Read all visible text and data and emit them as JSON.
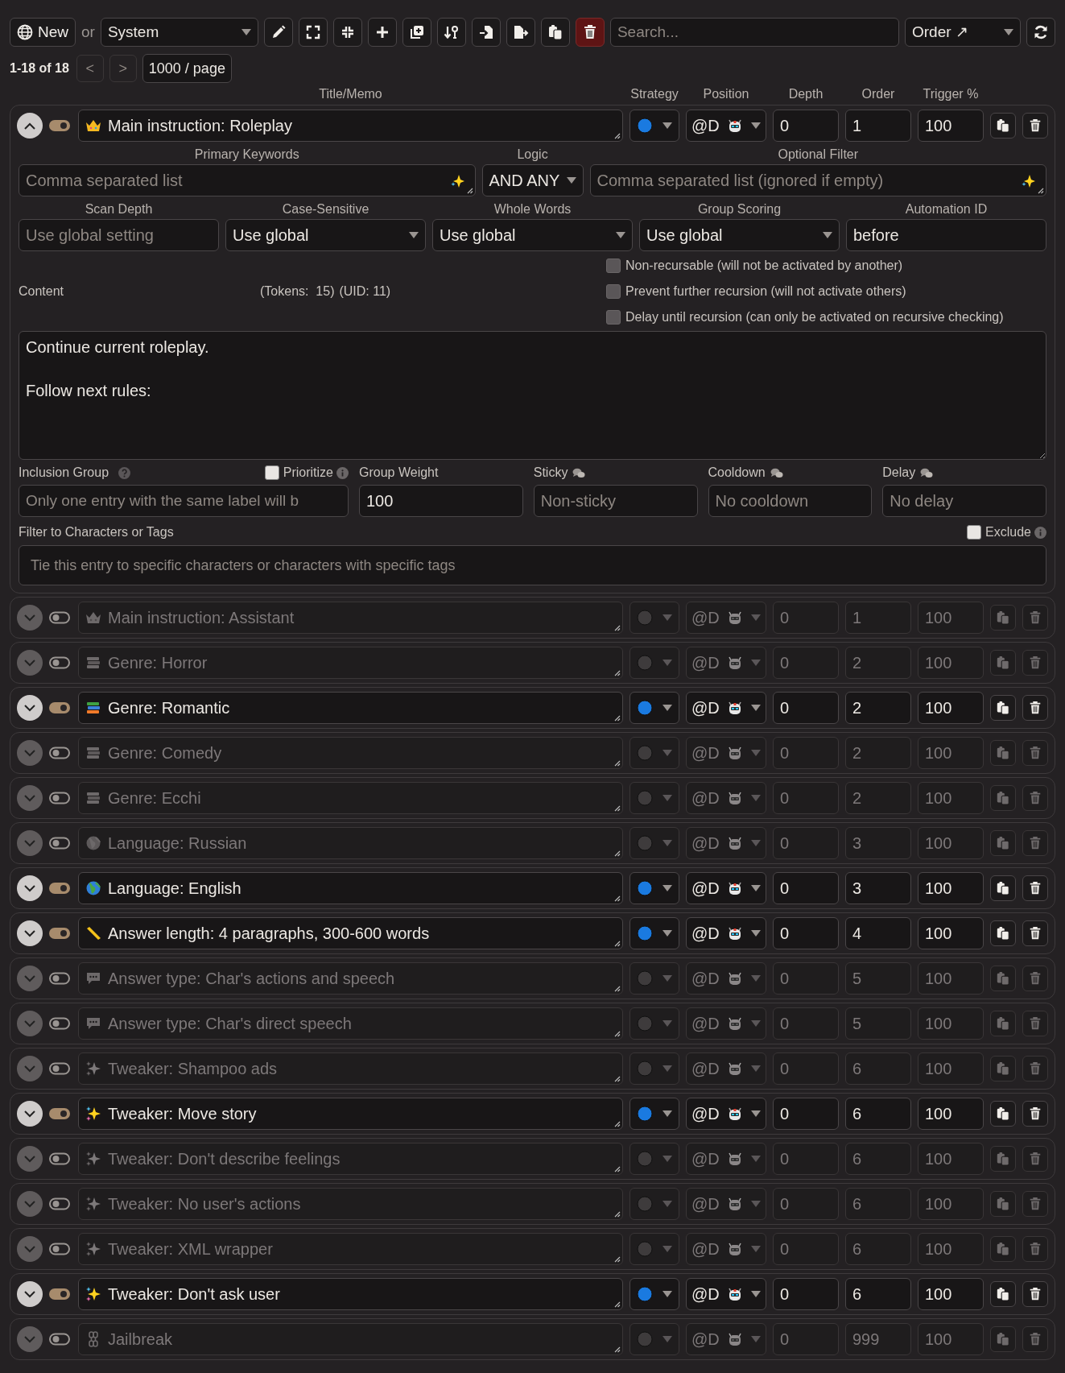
{
  "toolbar": {
    "new_button": "New",
    "or_label": "or",
    "book_select": "System",
    "search": {
      "placeholder": "Search..."
    },
    "sort_select": "Order ↗"
  },
  "pagination": {
    "range": "1-18 of 18",
    "prev": "<",
    "next": ">",
    "per_page": "1000 / page"
  },
  "column_headers": [
    "Title/Memo",
    "Strategy",
    "Position",
    "Depth",
    "Order",
    "Trigger %"
  ],
  "entries": [
    {
      "kind": "crown",
      "title": "Main instruction: Roleplay",
      "enabled": true,
      "expanded": true,
      "position": "@D",
      "depth": "0",
      "order": "1",
      "trigger": "100"
    },
    {
      "kind": "crown",
      "title": "Main instruction: Assistant",
      "enabled": false,
      "expanded": false,
      "position": "@D",
      "depth": "0",
      "order": "1",
      "trigger": "100"
    },
    {
      "kind": "books",
      "title": "Genre: Horror",
      "enabled": false,
      "expanded": false,
      "position": "@D",
      "depth": "0",
      "order": "2",
      "trigger": "100"
    },
    {
      "kind": "books",
      "title": "Genre: Romantic",
      "enabled": true,
      "expanded": false,
      "position": "@D",
      "depth": "0",
      "order": "2",
      "trigger": "100"
    },
    {
      "kind": "books",
      "title": "Genre: Comedy",
      "enabled": false,
      "expanded": false,
      "position": "@D",
      "depth": "0",
      "order": "2",
      "trigger": "100"
    },
    {
      "kind": "books",
      "title": "Genre: Ecchi",
      "enabled": false,
      "expanded": false,
      "position": "@D",
      "depth": "0",
      "order": "2",
      "trigger": "100"
    },
    {
      "kind": "globe",
      "title": "Language: Russian",
      "enabled": false,
      "expanded": false,
      "position": "@D",
      "depth": "0",
      "order": "3",
      "trigger": "100"
    },
    {
      "kind": "globe",
      "title": "Language: English",
      "enabled": true,
      "expanded": false,
      "position": "@D",
      "depth": "0",
      "order": "3",
      "trigger": "100"
    },
    {
      "kind": "ruler",
      "title": "Answer length: 4 paragraphs, 300-600 words",
      "enabled": true,
      "expanded": false,
      "position": "@D",
      "depth": "0",
      "order": "4",
      "trigger": "100"
    },
    {
      "kind": "speech",
      "title": "Answer type: Char's actions and speech",
      "enabled": false,
      "expanded": false,
      "position": "@D",
      "depth": "0",
      "order": "5",
      "trigger": "100"
    },
    {
      "kind": "speech",
      "title": "Answer type: Char's direct speech",
      "enabled": false,
      "expanded": false,
      "position": "@D",
      "depth": "0",
      "order": "5",
      "trigger": "100"
    },
    {
      "kind": "sparkles",
      "title": "Tweaker: Shampoo ads",
      "enabled": false,
      "expanded": false,
      "position": "@D",
      "depth": "0",
      "order": "6",
      "trigger": "100"
    },
    {
      "kind": "sparkles",
      "title": "Tweaker: Move story",
      "enabled": true,
      "expanded": false,
      "position": "@D",
      "depth": "0",
      "order": "6",
      "trigger": "100"
    },
    {
      "kind": "sparkles",
      "title": "Tweaker: Don't describe feelings",
      "enabled": false,
      "expanded": false,
      "position": "@D",
      "depth": "0",
      "order": "6",
      "trigger": "100"
    },
    {
      "kind": "sparkles",
      "title": "Tweaker: No user's actions",
      "enabled": false,
      "expanded": false,
      "position": "@D",
      "depth": "0",
      "order": "6",
      "trigger": "100"
    },
    {
      "kind": "sparkles",
      "title": "Tweaker: XML wrapper",
      "enabled": false,
      "expanded": false,
      "position": "@D",
      "depth": "0",
      "order": "6",
      "trigger": "100"
    },
    {
      "kind": "sparkles",
      "title": "Tweaker: Don't ask user",
      "enabled": true,
      "expanded": false,
      "position": "@D",
      "depth": "0",
      "order": "6",
      "trigger": "100"
    },
    {
      "kind": "chain",
      "title": "Jailbreak",
      "enabled": false,
      "expanded": false,
      "position": "@D",
      "depth": "0",
      "order": "999",
      "trigger": "100"
    }
  ],
  "details": {
    "primary_keywords": {
      "label": "Primary Keywords",
      "placeholder": "Comma separated list"
    },
    "logic": {
      "label": "Logic",
      "value": "AND ANY"
    },
    "optional_filter": {
      "label": "Optional Filter",
      "placeholder": "Comma separated list (ignored if empty)"
    },
    "scan_depth": {
      "label": "Scan Depth",
      "placeholder": "Use global setting"
    },
    "case_sensitive": {
      "label": "Case-Sensitive",
      "value": "Use global"
    },
    "whole_words": {
      "label": "Whole Words",
      "value": "Use global"
    },
    "group_scoring": {
      "label": "Group Scoring",
      "value": "Use global"
    },
    "automation_id": {
      "label": "Automation ID",
      "value": "before"
    },
    "content_label": "Content",
    "tokens": "(Tokens:  15)",
    "uid": "(UID: 11)",
    "checkboxes": [
      {
        "label": "Non-recursable (will not be activated by another)",
        "checked": false
      },
      {
        "label": "Prevent further recursion (will not activate others)",
        "checked": false
      },
      {
        "label": "Delay until recursion (can only be activated on recursive checking)",
        "checked": false
      }
    ],
    "content": "Continue current roleplay.\n\nFollow next rules:",
    "inclusion_group": {
      "label": "Inclusion Group",
      "placeholder": "Only one entry with the same label will b"
    },
    "prioritize": {
      "label": "Prioritize",
      "checked": false
    },
    "group_weight": {
      "label": "Group Weight",
      "value": "100"
    },
    "sticky": {
      "label": "Sticky",
      "placeholder": "Non-sticky"
    },
    "cooldown": {
      "label": "Cooldown",
      "placeholder": "No cooldown"
    },
    "delay": {
      "label": "Delay",
      "placeholder": "No delay"
    },
    "filter_label": "Filter to Characters or Tags",
    "exclude": {
      "label": "Exclude",
      "checked": false
    },
    "filter": {
      "placeholder": "Tie this entry to specific characters or characters with specific tags"
    }
  }
}
